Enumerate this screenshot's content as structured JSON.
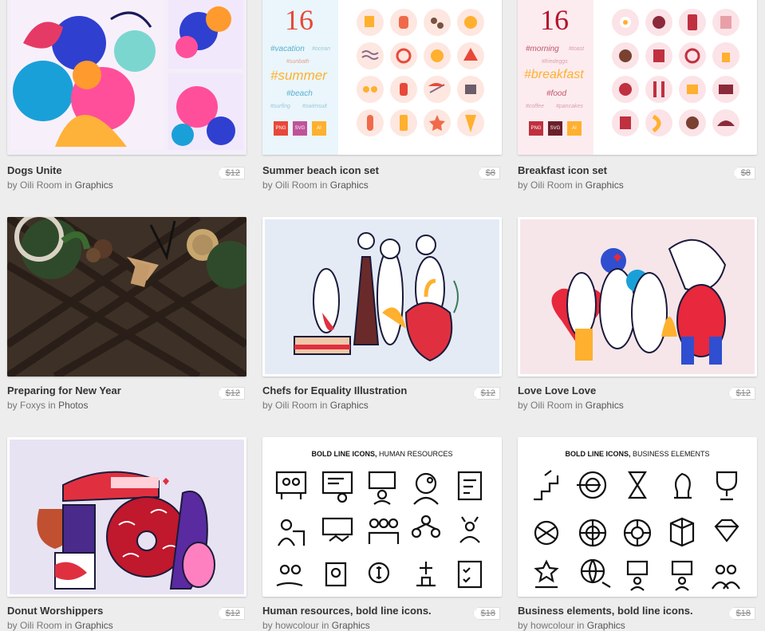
{
  "products": [
    {
      "title": "Dogs Unite",
      "by": "by",
      "author": "Oili Room",
      "in": "in",
      "category": "Graphics",
      "price": "$12"
    },
    {
      "title": "Summer beach icon set",
      "by": "by",
      "author": "Oili Room",
      "in": "in",
      "category": "Graphics",
      "price": "$8",
      "thumb": {
        "count": "16",
        "tags": [
          "#vacation",
          "#ocean",
          "#sunbath",
          "#summer",
          "#beach",
          "#surfing",
          "#swimsuit"
        ],
        "formats": [
          "PNG",
          "SVG",
          "AI"
        ]
      }
    },
    {
      "title": "Breakfast icon set",
      "by": "by",
      "author": "Oili Room",
      "in": "in",
      "category": "Graphics",
      "price": "$8",
      "thumb": {
        "count": "16",
        "tags": [
          "#morning",
          "#toast",
          "#friedeggs",
          "#breakfast",
          "#food",
          "#coffee",
          "#pancakes"
        ],
        "formats": [
          "PNG",
          "SVG",
          "AI"
        ]
      }
    },
    {
      "title": "Preparing for New Year",
      "by": "by",
      "author": "Foxys",
      "in": "in",
      "category": "Photos",
      "price": "$12"
    },
    {
      "title": "Chefs for Equality Illustration",
      "by": "by",
      "author": "Oili Room",
      "in": "in",
      "category": "Graphics",
      "price": "$12"
    },
    {
      "title": "Love Love Love",
      "by": "by",
      "author": "Oili Room",
      "in": "in",
      "category": "Graphics",
      "price": "$12"
    },
    {
      "title": "Donut Worshippers",
      "by": "by",
      "author": "Oili Room",
      "in": "in",
      "category": "Graphics",
      "price": "$12"
    },
    {
      "title": "Human resources, bold line icons.",
      "by": "by",
      "author": "howcolour",
      "in": "in",
      "category": "Graphics",
      "price": "$18",
      "thumb": {
        "heading_bold": "BOLD LINE ICONS,",
        "heading_rest": " HUMAN RESOURCES"
      }
    },
    {
      "title": "Business elements, bold line icons.",
      "by": "by",
      "author": "howcolour",
      "in": "in",
      "category": "Graphics",
      "price": "$18",
      "thumb": {
        "heading_bold": "BOLD LINE ICONS,",
        "heading_rest": " BUSINESS ELEMENTS"
      }
    }
  ],
  "colors": {
    "price_tag_bg": "#ffffff",
    "title": "#333333",
    "meta": "#777777",
    "page_bg": "#ededed"
  }
}
